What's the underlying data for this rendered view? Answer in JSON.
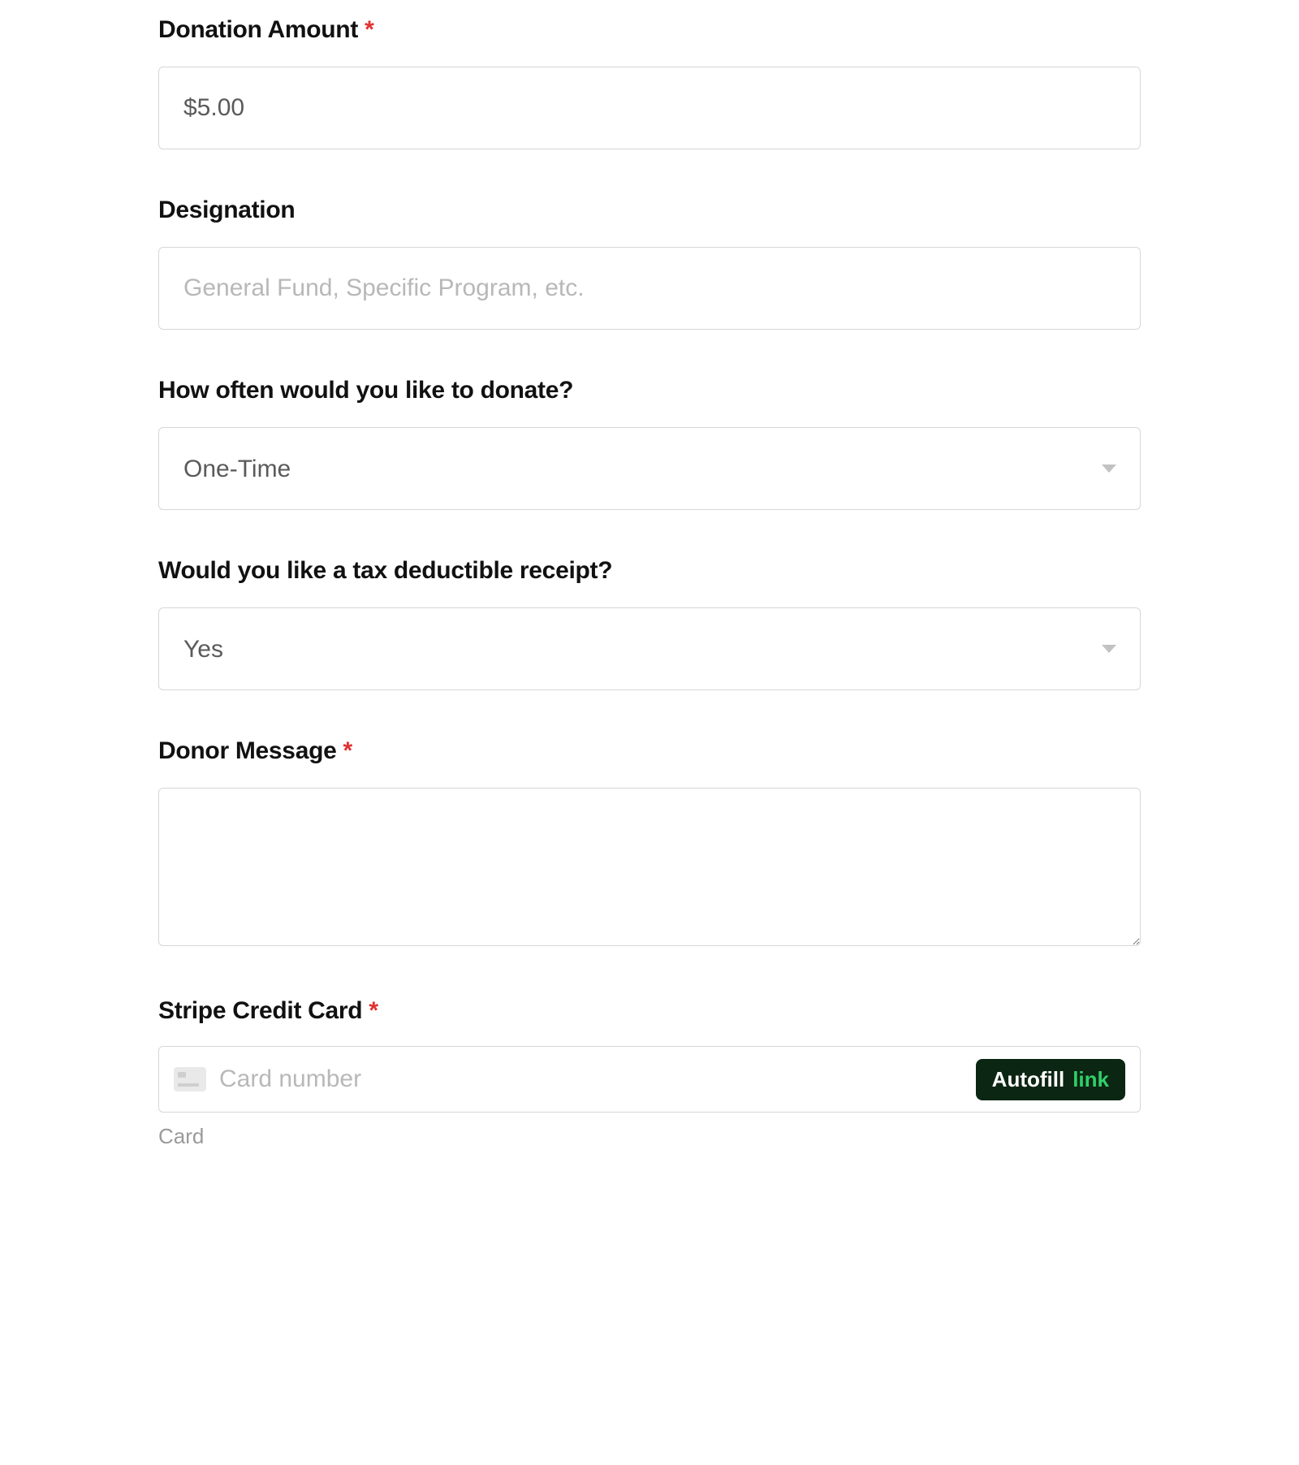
{
  "form": {
    "donation_amount": {
      "label": "Donation Amount",
      "required": true,
      "value": "$5.00"
    },
    "designation": {
      "label": "Designation",
      "required": false,
      "placeholder": "General Fund, Specific Program, etc.",
      "value": ""
    },
    "frequency": {
      "label": "How often would you like to donate?",
      "required": false,
      "selected": "One-Time"
    },
    "tax_receipt": {
      "label": "Would you like a tax deductible receipt?",
      "required": false,
      "selected": "Yes"
    },
    "donor_message": {
      "label": "Donor Message",
      "required": true,
      "value": ""
    },
    "stripe_card": {
      "label": "Stripe Credit Card",
      "required": true,
      "placeholder": "Card number",
      "autofill_label": "Autofill",
      "autofill_brand": "link",
      "helper": "Card"
    }
  },
  "required_marker": "*"
}
